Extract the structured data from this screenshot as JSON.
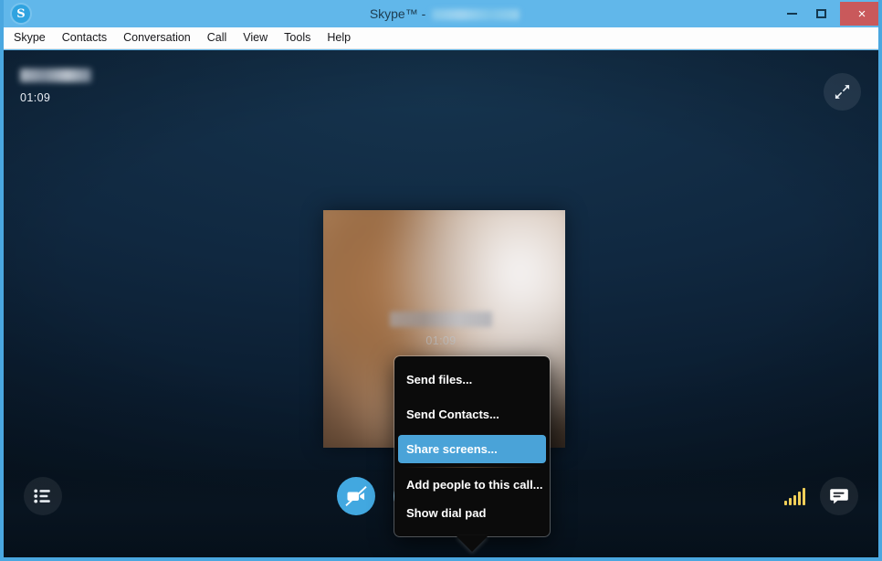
{
  "window": {
    "logo_letter": "S",
    "title_prefix": "Skype™ - ",
    "title_account_redacted": true,
    "controls": {
      "minimize_label": "",
      "maximize_label": "",
      "close_label": "×"
    }
  },
  "menu_bar": {
    "items": [
      {
        "label": "Skype"
      },
      {
        "label": "Contacts"
      },
      {
        "label": "Conversation"
      },
      {
        "label": "Call"
      },
      {
        "label": "View"
      },
      {
        "label": "Tools"
      },
      {
        "label": "Help"
      }
    ]
  },
  "call": {
    "caller_name_redacted": true,
    "timer": "01:09",
    "video_overlay_timer": "01:09",
    "video_overlay_name_redacted": true,
    "fullscreen_icon": "expand-diagonal-icon"
  },
  "context_menu": {
    "items": [
      {
        "label": "Send files...",
        "selected": false,
        "separator_after": false
      },
      {
        "label": "Send Contacts...",
        "selected": false,
        "separator_after": false
      },
      {
        "label": "Share screens...",
        "selected": true,
        "separator_after": true
      },
      {
        "label": "Add people to this call...",
        "selected": false,
        "separator_after": false
      },
      {
        "label": "Show dial pad",
        "selected": false,
        "separator_after": false
      }
    ]
  },
  "call_controls": {
    "video_toggle": {
      "icon": "video-camera-off-icon",
      "state": "off"
    },
    "microphone": {
      "icon": "microphone-icon",
      "state": "on"
    },
    "add": {
      "icon": "plus-icon",
      "state": "active"
    },
    "hangup": {
      "icon": "phone-hangup-icon"
    }
  },
  "side_controls": {
    "list_panel": {
      "icon": "list-menu-icon"
    },
    "chat_panel": {
      "icon": "chat-bubble-icon"
    },
    "signal": {
      "icon": "signal-bars-icon",
      "bars": 5,
      "color": "#f0cf58"
    }
  },
  "colors": {
    "title_bar": "#61b7ea",
    "window_border": "#4aa7e0",
    "close_button": "#c9595b",
    "accent_blue": "#42a8e0",
    "menu_highlight": "#4aa3d8",
    "hangup_red": "#d9453f",
    "add_button": "#2a5f80",
    "stage_dark": "#0b1d30"
  }
}
